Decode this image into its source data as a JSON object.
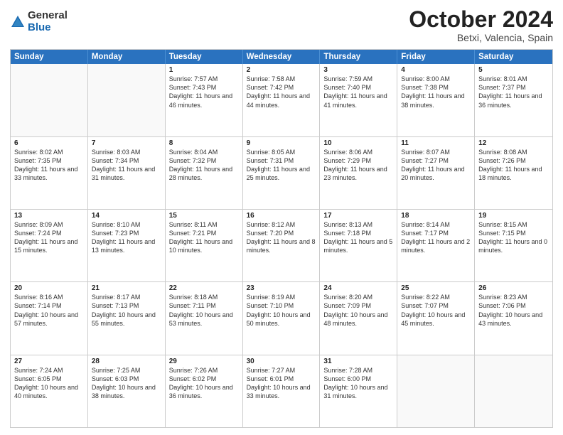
{
  "logo": {
    "general": "General",
    "blue": "Blue"
  },
  "title": "October 2024",
  "location": "Betxi, Valencia, Spain",
  "header_days": [
    "Sunday",
    "Monday",
    "Tuesday",
    "Wednesday",
    "Thursday",
    "Friday",
    "Saturday"
  ],
  "weeks": [
    [
      {
        "day": "",
        "text": ""
      },
      {
        "day": "",
        "text": ""
      },
      {
        "day": "1",
        "text": "Sunrise: 7:57 AM\nSunset: 7:43 PM\nDaylight: 11 hours and 46 minutes."
      },
      {
        "day": "2",
        "text": "Sunrise: 7:58 AM\nSunset: 7:42 PM\nDaylight: 11 hours and 44 minutes."
      },
      {
        "day": "3",
        "text": "Sunrise: 7:59 AM\nSunset: 7:40 PM\nDaylight: 11 hours and 41 minutes."
      },
      {
        "day": "4",
        "text": "Sunrise: 8:00 AM\nSunset: 7:38 PM\nDaylight: 11 hours and 38 minutes."
      },
      {
        "day": "5",
        "text": "Sunrise: 8:01 AM\nSunset: 7:37 PM\nDaylight: 11 hours and 36 minutes."
      }
    ],
    [
      {
        "day": "6",
        "text": "Sunrise: 8:02 AM\nSunset: 7:35 PM\nDaylight: 11 hours and 33 minutes."
      },
      {
        "day": "7",
        "text": "Sunrise: 8:03 AM\nSunset: 7:34 PM\nDaylight: 11 hours and 31 minutes."
      },
      {
        "day": "8",
        "text": "Sunrise: 8:04 AM\nSunset: 7:32 PM\nDaylight: 11 hours and 28 minutes."
      },
      {
        "day": "9",
        "text": "Sunrise: 8:05 AM\nSunset: 7:31 PM\nDaylight: 11 hours and 25 minutes."
      },
      {
        "day": "10",
        "text": "Sunrise: 8:06 AM\nSunset: 7:29 PM\nDaylight: 11 hours and 23 minutes."
      },
      {
        "day": "11",
        "text": "Sunrise: 8:07 AM\nSunset: 7:27 PM\nDaylight: 11 hours and 20 minutes."
      },
      {
        "day": "12",
        "text": "Sunrise: 8:08 AM\nSunset: 7:26 PM\nDaylight: 11 hours and 18 minutes."
      }
    ],
    [
      {
        "day": "13",
        "text": "Sunrise: 8:09 AM\nSunset: 7:24 PM\nDaylight: 11 hours and 15 minutes."
      },
      {
        "day": "14",
        "text": "Sunrise: 8:10 AM\nSunset: 7:23 PM\nDaylight: 11 hours and 13 minutes."
      },
      {
        "day": "15",
        "text": "Sunrise: 8:11 AM\nSunset: 7:21 PM\nDaylight: 11 hours and 10 minutes."
      },
      {
        "day": "16",
        "text": "Sunrise: 8:12 AM\nSunset: 7:20 PM\nDaylight: 11 hours and 8 minutes."
      },
      {
        "day": "17",
        "text": "Sunrise: 8:13 AM\nSunset: 7:18 PM\nDaylight: 11 hours and 5 minutes."
      },
      {
        "day": "18",
        "text": "Sunrise: 8:14 AM\nSunset: 7:17 PM\nDaylight: 11 hours and 2 minutes."
      },
      {
        "day": "19",
        "text": "Sunrise: 8:15 AM\nSunset: 7:15 PM\nDaylight: 11 hours and 0 minutes."
      }
    ],
    [
      {
        "day": "20",
        "text": "Sunrise: 8:16 AM\nSunset: 7:14 PM\nDaylight: 10 hours and 57 minutes."
      },
      {
        "day": "21",
        "text": "Sunrise: 8:17 AM\nSunset: 7:13 PM\nDaylight: 10 hours and 55 minutes."
      },
      {
        "day": "22",
        "text": "Sunrise: 8:18 AM\nSunset: 7:11 PM\nDaylight: 10 hours and 53 minutes."
      },
      {
        "day": "23",
        "text": "Sunrise: 8:19 AM\nSunset: 7:10 PM\nDaylight: 10 hours and 50 minutes."
      },
      {
        "day": "24",
        "text": "Sunrise: 8:20 AM\nSunset: 7:09 PM\nDaylight: 10 hours and 48 minutes."
      },
      {
        "day": "25",
        "text": "Sunrise: 8:22 AM\nSunset: 7:07 PM\nDaylight: 10 hours and 45 minutes."
      },
      {
        "day": "26",
        "text": "Sunrise: 8:23 AM\nSunset: 7:06 PM\nDaylight: 10 hours and 43 minutes."
      }
    ],
    [
      {
        "day": "27",
        "text": "Sunrise: 7:24 AM\nSunset: 6:05 PM\nDaylight: 10 hours and 40 minutes."
      },
      {
        "day": "28",
        "text": "Sunrise: 7:25 AM\nSunset: 6:03 PM\nDaylight: 10 hours and 38 minutes."
      },
      {
        "day": "29",
        "text": "Sunrise: 7:26 AM\nSunset: 6:02 PM\nDaylight: 10 hours and 36 minutes."
      },
      {
        "day": "30",
        "text": "Sunrise: 7:27 AM\nSunset: 6:01 PM\nDaylight: 10 hours and 33 minutes."
      },
      {
        "day": "31",
        "text": "Sunrise: 7:28 AM\nSunset: 6:00 PM\nDaylight: 10 hours and 31 minutes."
      },
      {
        "day": "",
        "text": ""
      },
      {
        "day": "",
        "text": ""
      }
    ]
  ]
}
